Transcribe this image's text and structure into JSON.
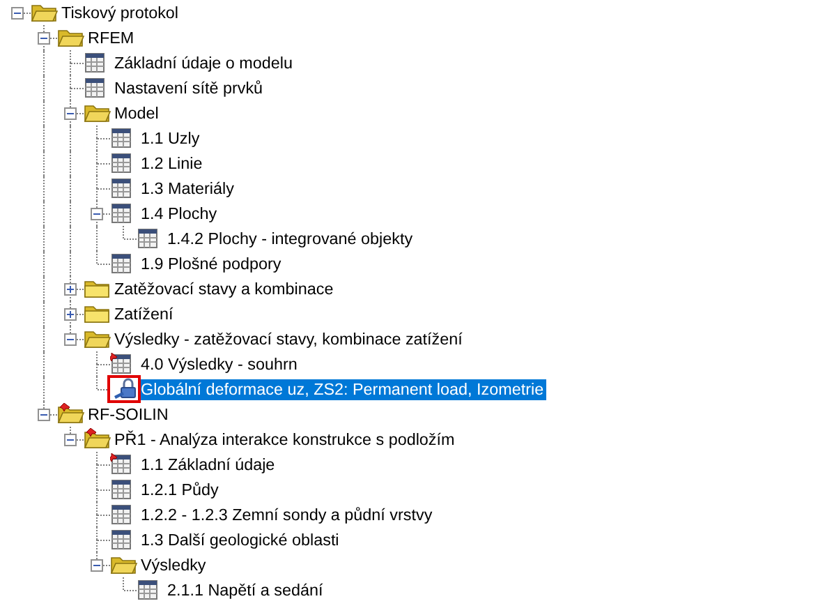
{
  "tree": [
    {
      "label": "Tiskový protokol",
      "kind": "folder",
      "expanded": true,
      "selected": false,
      "children": [
        {
          "label": "RFEM",
          "kind": "folder",
          "expanded": true,
          "selected": false,
          "children": [
            {
              "label": "Základní údaje o modelu",
              "kind": "table",
              "selected": false
            },
            {
              "label": "Nastavení sítě prvků",
              "kind": "table",
              "selected": false
            },
            {
              "label": "Model",
              "kind": "folder",
              "expanded": true,
              "selected": false,
              "children": [
                {
                  "label": "1.1 Uzly",
                  "kind": "table",
                  "selected": false
                },
                {
                  "label": "1.2 Linie",
                  "kind": "table",
                  "selected": false
                },
                {
                  "label": "1.3 Materiály",
                  "kind": "table",
                  "selected": false
                },
                {
                  "label": "1.4 Plochy",
                  "kind": "table",
                  "expanded": true,
                  "selected": false,
                  "children": [
                    {
                      "label": "1.4.2 Plochy - integrované objekty",
                      "kind": "table",
                      "selected": false
                    }
                  ]
                },
                {
                  "label": "1.9 Plošné podpory",
                  "kind": "table",
                  "selected": false
                }
              ]
            },
            {
              "label": "Zatěžovací stavy a kombinace",
              "kind": "folder",
              "expanded": false,
              "selected": false
            },
            {
              "label": "Zatížení",
              "kind": "folder",
              "expanded": false,
              "selected": false
            },
            {
              "label": "Výsledky - zatěžovací stavy, kombinace zatížení",
              "kind": "folder",
              "expanded": true,
              "selected": false,
              "children": [
                {
                  "label": "4.0 Výsledky - souhrn",
                  "kind": "pinned-table",
                  "selected": false
                },
                {
                  "label": "Globální deformace uz, ZS2: Permanent load, Izometrie",
                  "kind": "graphic",
                  "selected": true,
                  "framed": true
                }
              ]
            }
          ]
        },
        {
          "label": "RF-SOILIN",
          "kind": "pinned-folder",
          "expanded": true,
          "selected": false,
          "children": [
            {
              "label": "PŘ1 - Analýza interakce konstrukce s podložím",
              "kind": "pinned-folder",
              "expanded": true,
              "selected": false,
              "children": [
                {
                  "label": "1.1 Základní údaje",
                  "kind": "pinned-table",
                  "selected": false
                },
                {
                  "label": "1.2.1 Půdy",
                  "kind": "table",
                  "selected": false
                },
                {
                  "label": "1.2.2 - 1.2.3 Zemní sondy a půdní vrstvy",
                  "kind": "table",
                  "selected": false
                },
                {
                  "label": "1.3 Další geologické oblasti",
                  "kind": "table",
                  "selected": false
                },
                {
                  "label": "Výsledky",
                  "kind": "folder",
                  "expanded": true,
                  "selected": false,
                  "children": [
                    {
                      "label": "2.1.1 Napětí a sedání",
                      "kind": "table",
                      "selected": false
                    }
                  ]
                }
              ]
            }
          ]
        }
      ]
    }
  ]
}
